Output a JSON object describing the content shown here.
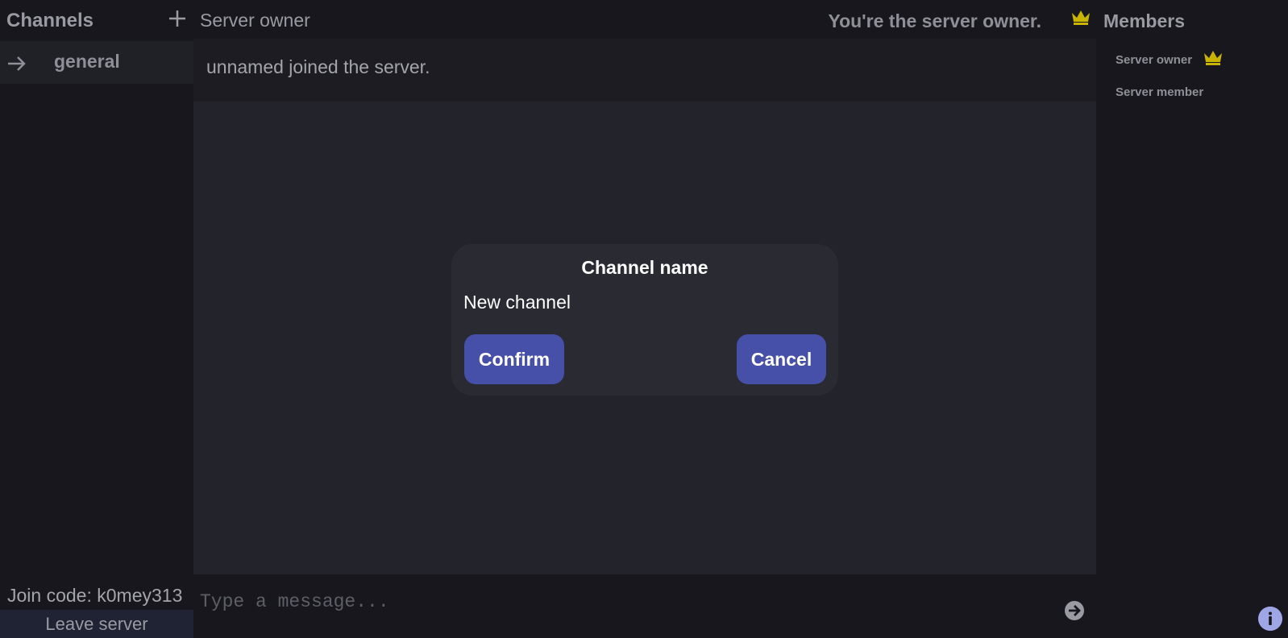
{
  "sidebar": {
    "title": "Channels",
    "channels": [
      {
        "label": "general",
        "active": true
      }
    ],
    "join_code": "Join code: k0mey313",
    "leave_label": "Leave server"
  },
  "header": {
    "server_name": "Server owner",
    "owner_status": "You're the server owner."
  },
  "chat": {
    "messages": [
      {
        "text": "unnamed joined the server."
      }
    ],
    "input_placeholder": "Type a message..."
  },
  "modal": {
    "title": "Channel name",
    "input_value": "New channel",
    "confirm_label": "Confirm",
    "cancel_label": "Cancel"
  },
  "members": {
    "title": "Members",
    "list": [
      {
        "name": "Server owner",
        "is_owner": true
      },
      {
        "name": "Server member",
        "is_owner": false
      }
    ]
  },
  "colors": {
    "accent": "#4650a8",
    "crown": "#c9b400",
    "background": "#17171d",
    "chat_background": "#23232c"
  },
  "icons": {
    "add": "plus-icon",
    "channel": "arrow-right-icon",
    "owner": "crown-icon",
    "send": "send-icon",
    "info": "info-icon"
  }
}
